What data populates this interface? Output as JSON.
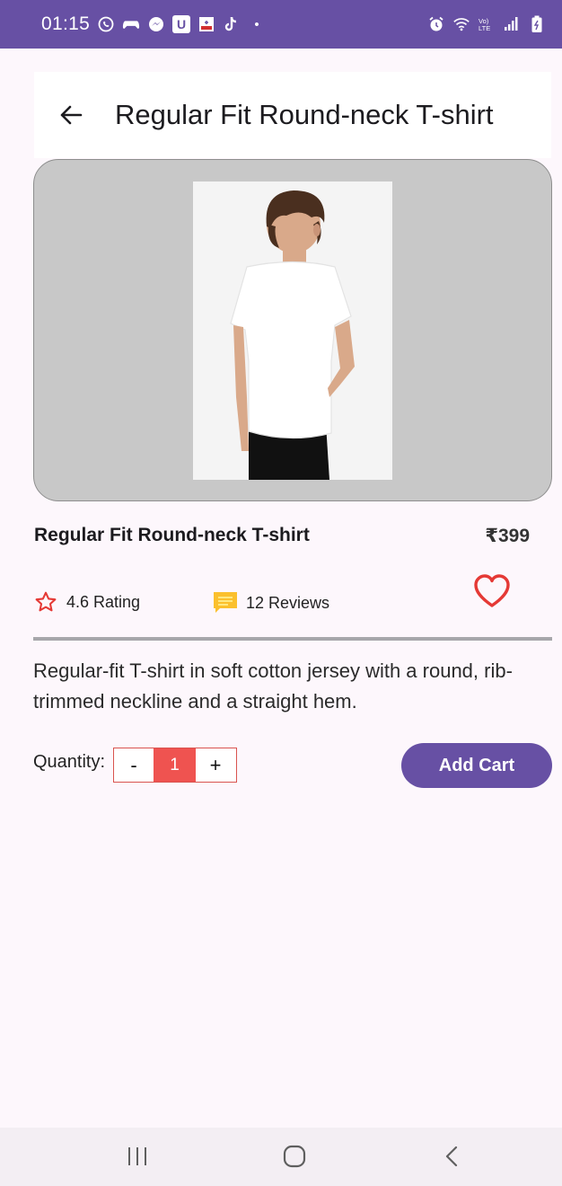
{
  "status_bar": {
    "time": "01:15",
    "dot": "•",
    "left_icons": [
      "whatsapp-icon",
      "gamepad-icon",
      "messenger-icon",
      "u-app-icon",
      "news-icon",
      "tiktok-icon"
    ],
    "right_icons": [
      "alarm-icon",
      "wifi-icon",
      "volte-icon",
      "signal-icon",
      "battery-icon"
    ],
    "volte_label": "Vo) LTE"
  },
  "app_bar": {
    "title": "Regular Fit Round-neck T-shirt"
  },
  "product": {
    "name": "Regular Fit Round-neck T-shirt",
    "price": "₹399",
    "rating_label": "4.6 Rating",
    "reviews_label": "12 Reviews",
    "description": "Regular-fit T-shirt in soft cotton jersey with a round, rib-trimmed neckline and a straight hem.",
    "favorite": false
  },
  "quantity": {
    "label": "Quantity:",
    "decrement": "-",
    "value": "1",
    "increment": "+"
  },
  "actions": {
    "add_cart": "Add Cart"
  },
  "colors": {
    "primary": "#6750a4",
    "accent_red": "#e53935",
    "qty_fill": "#ef5350",
    "review_yellow": "#fbc02d"
  }
}
